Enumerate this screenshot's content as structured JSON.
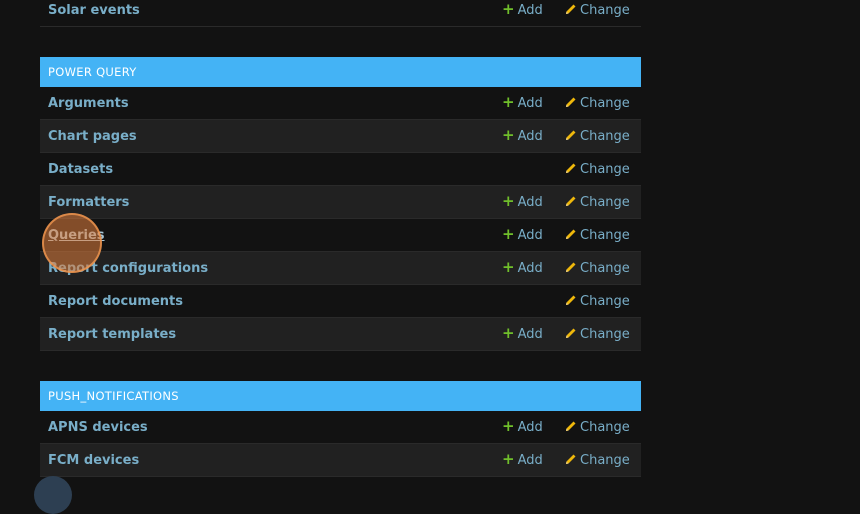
{
  "top_section": {
    "rows": [
      {
        "name": "Solar events",
        "add": "Add",
        "change": "Change"
      }
    ]
  },
  "power_query": {
    "caption": "POWER QUERY",
    "rows": [
      {
        "name": "Arguments",
        "add": "Add",
        "change": "Change"
      },
      {
        "name": "Chart pages",
        "add": "Add",
        "change": "Change"
      },
      {
        "name": "Datasets",
        "change": "Change"
      },
      {
        "name": "Formatters",
        "add": "Add",
        "change": "Change"
      },
      {
        "name": "Queries",
        "add": "Add",
        "change": "Change"
      },
      {
        "name": "Report configurations",
        "add": "Add",
        "change": "Change"
      },
      {
        "name": "Report documents",
        "change": "Change"
      },
      {
        "name": "Report templates",
        "add": "Add",
        "change": "Change"
      }
    ]
  },
  "push_notifications": {
    "caption": "PUSH_NOTIFICATIONS",
    "rows": [
      {
        "name": "APNS devices",
        "add": "Add",
        "change": "Change"
      },
      {
        "name": "FCM devices",
        "add": "Add",
        "change": "Change"
      }
    ]
  },
  "colors": {
    "background": "#121212",
    "caption_bg": "#44b3f5",
    "link": "#79aec8",
    "add_icon": "#70bf2b",
    "change_icon": "#efb80b"
  },
  "icons": {
    "add": "plus-icon",
    "change": "pencil-icon"
  }
}
